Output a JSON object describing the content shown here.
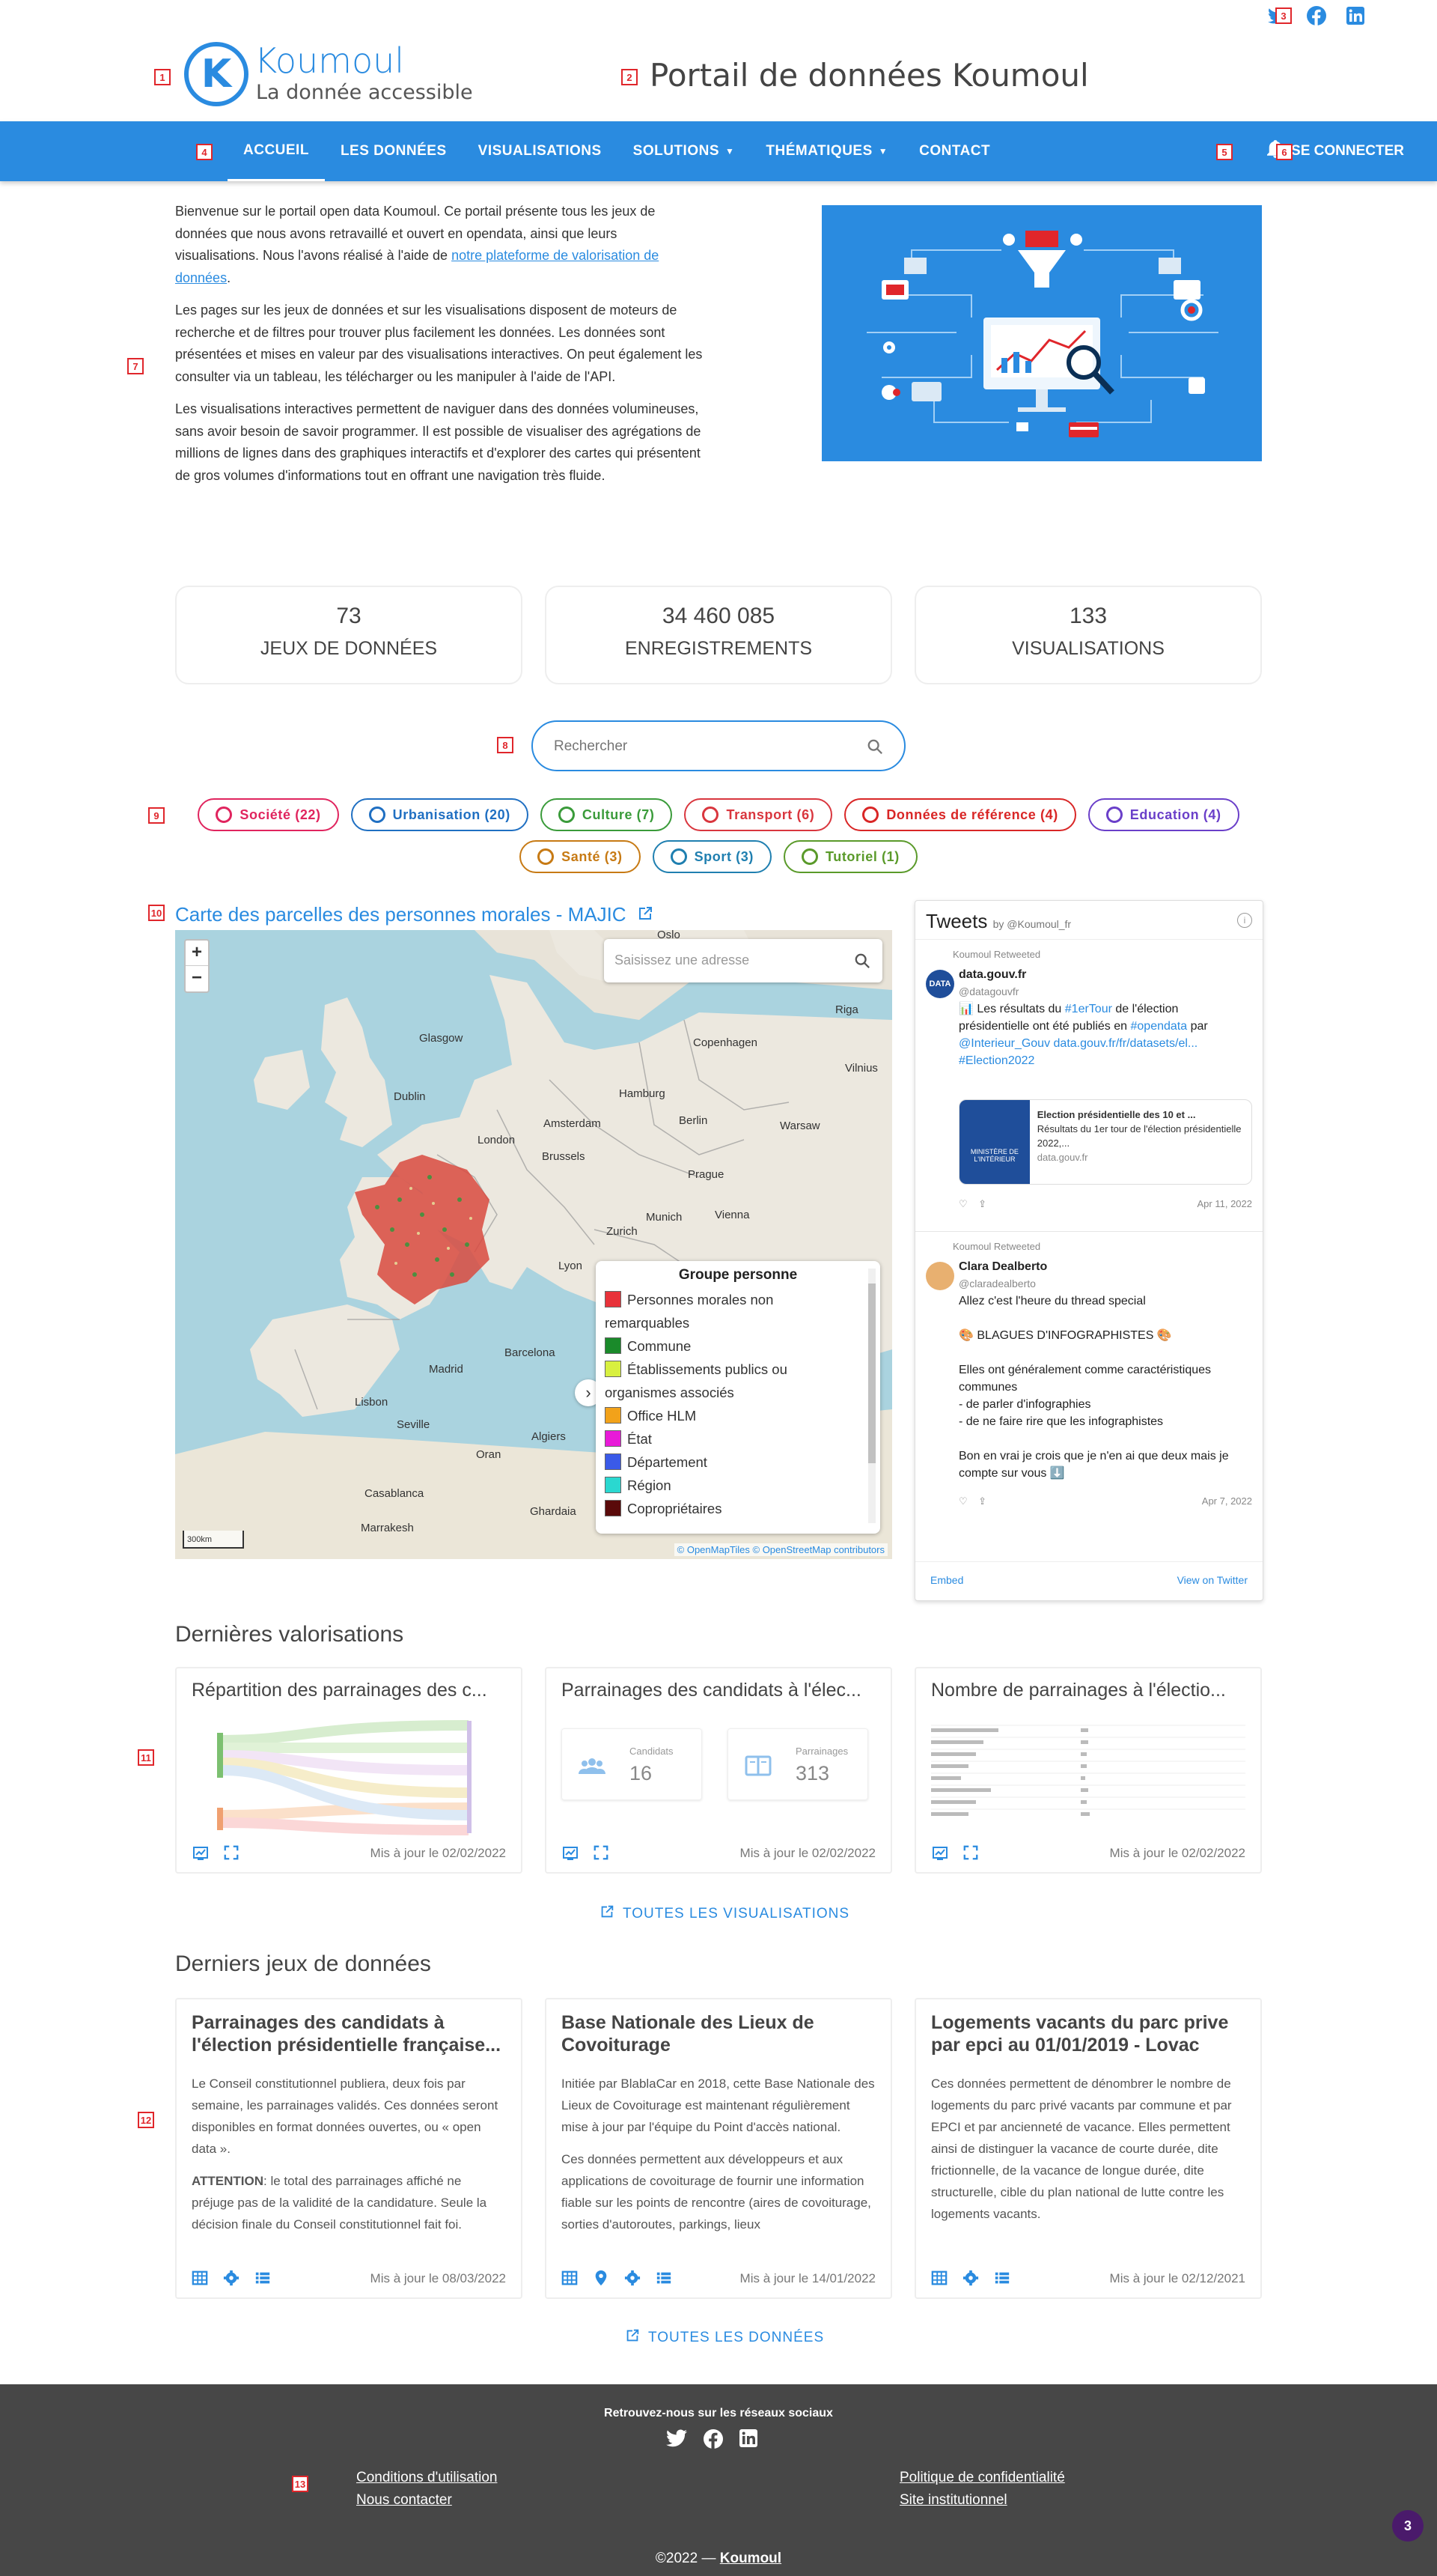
{
  "header": {
    "logo_name": "Koumoul",
    "logo_sub": "La donnée accessible",
    "site_title": "Portail de données Koumoul"
  },
  "annotations": [
    "1",
    "2",
    "3",
    "4",
    "5",
    "6",
    "7",
    "8",
    "9",
    "10",
    "11",
    "12",
    "13"
  ],
  "nav": {
    "items": [
      {
        "label": "Accueil",
        "active": true
      },
      {
        "label": "Les données"
      },
      {
        "label": "Visualisations"
      },
      {
        "label": "Solutions",
        "dropdown": true
      },
      {
        "label": "Thématiques",
        "dropdown": true
      },
      {
        "label": "Contact"
      }
    ],
    "login": "Se connecter"
  },
  "intro": {
    "p1_a": "Bienvenue sur le portail open data Koumoul. Ce portail présente tous les jeux de données que nous avons retravaillé et ouvert en opendata, ainsi que leurs visualisations. Nous l'avons réalisé à l'aide de ",
    "p1_link": "notre plateforme de valorisation de données",
    "p1_b": ".",
    "p2": "Les pages sur les jeux de données et sur les visualisations disposent de moteurs de recherche et de filtres pour trouver plus facilement les données. Les données sont présentées et mises en valeur par des visualisations interactives. On peut également les consulter via un tableau, les télécharger ou les manipuler à l'aide de l'API.",
    "p3": "Les visualisations interactives permettent de naviguer dans des données volumineuses, sans avoir besoin de savoir programmer. Il est possible de visualiser des agrégations de millions de lignes dans des graphiques interactifs et d'explorer des cartes qui présentent de gros volumes d'informations tout en offrant une navigation très fluide."
  },
  "stats": [
    {
      "value": "73",
      "label": "Jeux de données"
    },
    {
      "value": "34 460 085",
      "label": "Enregistrements"
    },
    {
      "value": "133",
      "label": "Visualisations"
    }
  ],
  "search": {
    "placeholder": "Rechercher"
  },
  "themes_row1": [
    {
      "label": "Société (22)",
      "color": "#e0245e"
    },
    {
      "label": "Urbanisation (20)",
      "color": "#1f6fc2"
    },
    {
      "label": "Culture (7)",
      "color": "#3a9b3a"
    },
    {
      "label": "Transport (6)",
      "color": "#d9363e"
    },
    {
      "label": "Données de référence (4)",
      "color": "#d92626"
    },
    {
      "label": "Education (4)",
      "color": "#6a3fc9"
    }
  ],
  "themes_row2": [
    {
      "label": "Santé (3)",
      "color": "#c77a14"
    },
    {
      "label": "Sport (3)",
      "color": "#1f7fb0"
    },
    {
      "label": "Tutoriel (1)",
      "color": "#5a9a2a"
    }
  ],
  "map": {
    "title": "Carte des parcelles des personnes morales - MAJIC",
    "search_placeholder": "Saisissez une adresse",
    "legend_title": "Groupe personne",
    "legend": [
      {
        "label": "Personnes morales non remarquables",
        "color": "#e8323a"
      },
      {
        "label": "Commune",
        "color": "#1a8a2a"
      },
      {
        "label": "Établissements publics ou organismes associés",
        "color": "#d8f040"
      },
      {
        "label": "Office HLM",
        "color": "#f2a21a"
      },
      {
        "label": "État",
        "color": "#e81ad8"
      },
      {
        "label": "Département",
        "color": "#3a5ae8"
      },
      {
        "label": "Région",
        "color": "#2ad8d0"
      },
      {
        "label": "Copropriétaires",
        "color": "#5a0a0a"
      }
    ],
    "places": [
      "Oslo",
      "Glasgow",
      "Riga",
      "Copenhagen",
      "Vilnius",
      "Dublin",
      "Hamburg",
      "London",
      "Amsterdam",
      "Berlin",
      "Warsaw",
      "Brussels",
      "Prague",
      "Munich",
      "Vienna",
      "Zurich",
      "Lyon",
      "Madrid",
      "Barcelona",
      "Lisbon",
      "Seville",
      "Algiers",
      "Oran",
      "Casablanca",
      "Marrakesh",
      "Ghardaia"
    ],
    "scale": "300km",
    "attribution": "© OpenMapTiles © OpenStreetMap contributors"
  },
  "tweets": {
    "title": "Tweets",
    "by": "by @Koumoul_fr",
    "items": [
      {
        "retweet": "Koumoul Retweeted",
        "name": "data.gouv.fr",
        "handle": "@datagouvfr",
        "text_plain": "📊 Les résultats du ",
        "text_parts": [
          "#1erTour",
          " de l'élection présidentielle ont été publiés en ",
          "#opendata",
          " par ",
          "@Interieur_Gouv",
          " ",
          "data.gouv.fr/fr/datasets/el...",
          " ",
          "#Election2022"
        ],
        "card_title": "Election présidentielle des 10 et ...",
        "card_desc": "Résultats du 1er tour de l'élection présidentielle 2022,...",
        "card_domain": "data.gouv.fr",
        "card_img_text": "MINISTÈRE DE L'INTÉRIEUR",
        "date": "Apr 11, 2022"
      },
      {
        "retweet": "Koumoul Retweeted",
        "name": "Clara Dealberto",
        "handle": "@claradealberto",
        "lines": [
          "Allez c'est l'heure du thread special",
          "",
          "🎨 BLAGUES D'INFOGRAPHISTES 🎨",
          "",
          "Elles ont généralement comme caractéristiques communes",
          "- de parler d'infographies",
          "- de ne faire rire que les infographistes",
          "",
          "Bon en vrai je crois que je n'en ai que deux mais je compte sur vous ⬇️"
        ],
        "date": "Apr 7, 2022"
      }
    ],
    "embed": "Embed",
    "view": "View on Twitter"
  },
  "valorisations": {
    "title": "Dernières valorisations",
    "cards": [
      {
        "title": "Répartition des parrainages des c...",
        "date": "Mis à jour le 02/02/2022"
      },
      {
        "title": "Parrainages des candidats à l'élec...",
        "date": "Mis à jour le 02/02/2022",
        "kpi1_label": "Candidats",
        "kpi1_value": "16",
        "kpi2_label": "Parrainages",
        "kpi2_value": "313"
      },
      {
        "title": "Nombre de parrainages à l'électio...",
        "date": "Mis à jour le 02/02/2022"
      }
    ],
    "more": "Toutes les visualisations"
  },
  "datasets": {
    "title": "Derniers jeux de données",
    "cards": [
      {
        "title": "Parrainages des candidats à l'élection présidentielle française...",
        "p1": "Le Conseil constitutionnel publiera, deux fois par semaine, les parrainages validés. Ces données seront disponibles en format données ouvertes, ou « open data ».",
        "p2_bold": "ATTENTION",
        "p2": ": le total des parrainages affiché ne préjuge pas de la validité de la candidature. Seule la décision finale du Conseil constitutionnel fait foi.",
        "date": "Mis à jour le 08/03/2022"
      },
      {
        "title": "Base Nationale des Lieux de Covoiturage",
        "p1": "Initiée par BlablaCar en 2018, cette Base Nationale des Lieux de Covoiturage est maintenant régulièrement mise à jour par l'équipe du Point d'accès national.",
        "p2": "Ces données permettent aux développeurs et aux applications de covoiturage de fournir une information fiable sur les points de rencontre (aires de covoiturage, sorties d'autoroutes, parkings, lieux",
        "date": "Mis à jour le 14/01/2022"
      },
      {
        "title": "Logements vacants du parc prive par epci au 01/01/2019 - Lovac",
        "p1": "Ces données permettent de dénombrer le nombre de logements du parc privé vacants par commune et par EPCI et par ancienneté de vacance. Elles permettent ainsi de distinguer la vacance de courte durée, dite frictionnelle, de la vacance de longue durée, dite structurelle, cible du plan national de lutte contre les logements vacants.",
        "date": "Mis à jour le 02/12/2021"
      }
    ],
    "more": "Toutes les données"
  },
  "footer": {
    "social_title": "Retrouvez-nous sur les réseaux sociaux",
    "links_left": [
      "Conditions d'utilisation",
      "Nous contacter"
    ],
    "links_right": [
      "Politique de confidentialité",
      "Site institutionnel"
    ],
    "copyright": "©2022 — ",
    "copyright_link": "Koumoul"
  },
  "notif_badge": "3",
  "colors": {
    "primary": "#2a8be0",
    "footer": "#474747",
    "badge": "#4a1a6b"
  }
}
